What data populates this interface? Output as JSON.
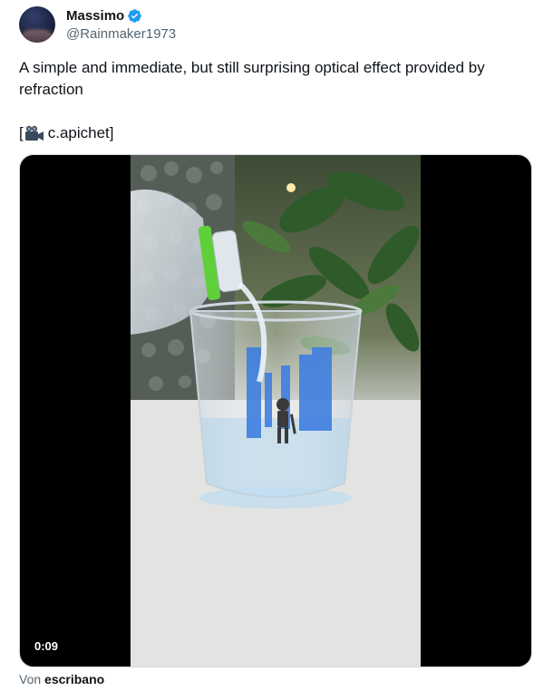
{
  "author": {
    "name": "Massimo",
    "handle": "@Rainmaker1973",
    "verified": true
  },
  "tweet": {
    "text": "A simple and immediate, but still surprising optical effect provided by refraction",
    "credit_open": "[",
    "credit_icon": "video-camera-icon",
    "credit_text": "c.apichet]"
  },
  "video": {
    "duration": "0:09"
  },
  "footer": {
    "prefix": "Von",
    "author": "escribano"
  },
  "colors": {
    "verified": "#1d9bf0",
    "text_primary": "#0f1419",
    "text_secondary": "#536471",
    "video_bg": "#000000",
    "bottle_cap": "#5fcf3a",
    "drawing_blue": "#3f7fe0"
  }
}
